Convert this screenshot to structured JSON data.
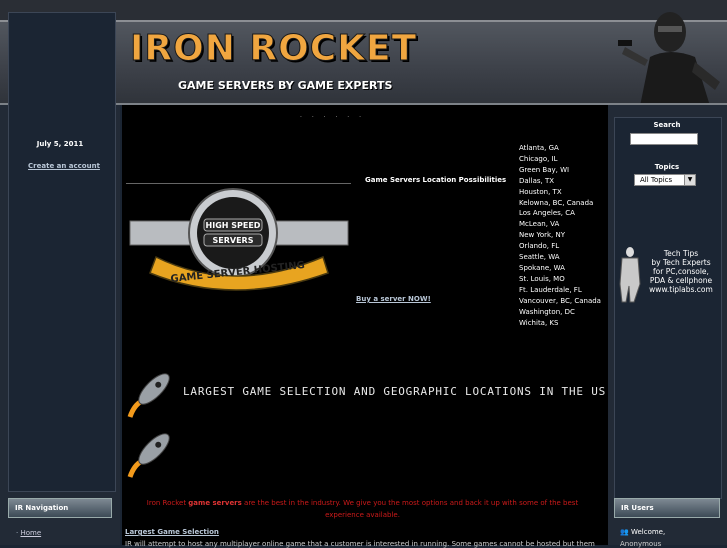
{
  "header": {
    "title": "IRON ROCKET",
    "subtitle": "GAME SERVERS BY GAME EXPERTS"
  },
  "left": {
    "date": "July 5, 2011",
    "create_account": "Create an account",
    "nav_title": "IR Navigation",
    "nav_items": [
      "Home"
    ]
  },
  "main": {
    "dots": "· · · · · ·",
    "locations_heading": "Game Servers Location Possibilities",
    "buy_link": "Buy a server NOW!",
    "cities": [
      "Atlanta, GA",
      "Chicago, IL",
      "Green Bay, WI",
      "Dallas, TX",
      "Houston, TX",
      "Kelowna, BC, Canada",
      "Los Angeles, CA",
      "McLean, VA",
      "New York, NY",
      "Orlando, FL",
      "Seattle, WA",
      "Spokane, WA",
      "St. Louis, MO",
      "Ft. Lauderdale, FL",
      "Vancouver, BC, Canada",
      "Washington, DC",
      "Wichita, KS"
    ],
    "banner": "LARGEST GAME SELECTION AND GEOGRAPHIC LOCATIONS IN THE US",
    "logo_top": "HIGH SPEED",
    "logo_mid": "SERVERS",
    "logo_bottom": "GAME SERVER HOSTING",
    "red_pre": "Iron Rocket ",
    "red_bold": "game servers",
    "red_post": " are the best in the industry. We give you the most options and back it up with some of the best experience available.",
    "largest_link": "Largest Game Selection",
    "bottom_text": "IR will attempt to host any multiplayer online game that a customer is interested in running. Some games cannot be hosted but them"
  },
  "right": {
    "search_label": "Search",
    "topics_label": "Topics",
    "topics_value": "All Topics",
    "techtips_lines": [
      "Tech Tips",
      "by Tech Experts",
      "for PC,console,",
      "PDA & cellphone",
      "www.tiplabs.com"
    ],
    "users_title": "IR Users",
    "welcome": "Welcome,",
    "anon": "Anonymous"
  },
  "colors": {
    "title_orange": "#f0a640",
    "link_blue": "#b8c6d6",
    "red_text": "#cc1a1a",
    "panel_bg": "#1b2533"
  }
}
